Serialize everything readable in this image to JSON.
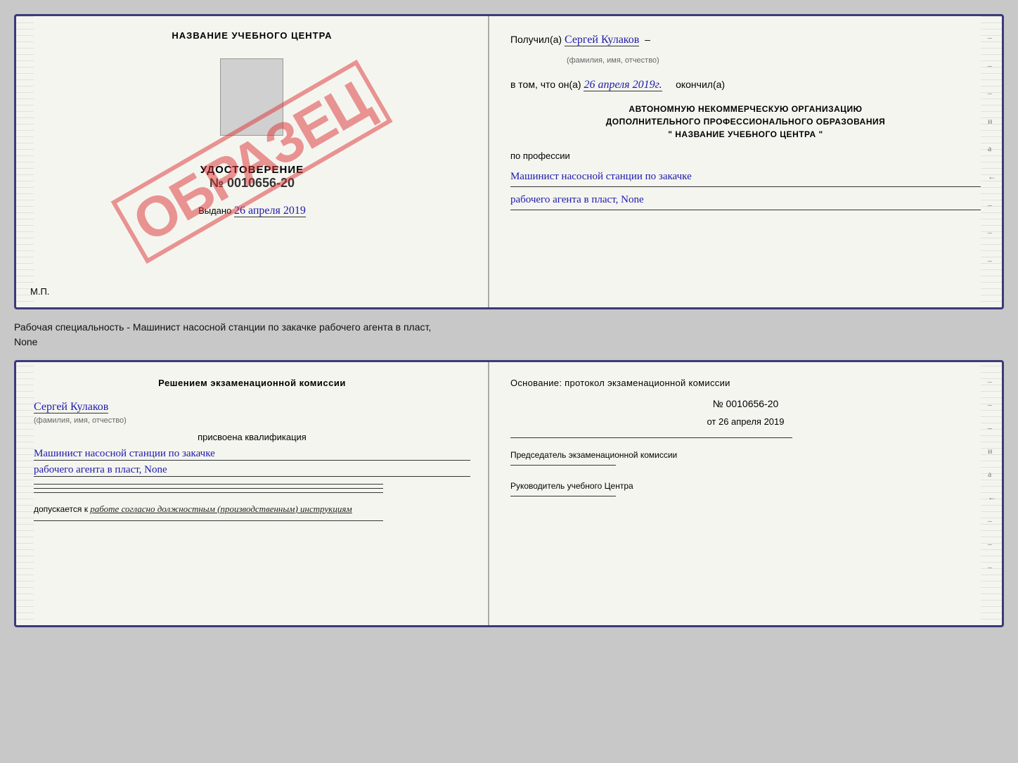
{
  "top_doc": {
    "left": {
      "title": "НАЗВАНИЕ УЧЕБНОГО ЦЕНТРА",
      "watermark": "ОБРАЗЕЦ",
      "udostoverenie": "УДОСТОВЕРЕНИЕ",
      "number": "№ 0010656-20",
      "vydano_label": "Выдано",
      "vydano_date": "26 апреля 2019",
      "mp": "М.П."
    },
    "right": {
      "poluchil_label": "Получил(a)",
      "recipient_name": "Сергей Кулаков",
      "recipient_subtitle": "(фамилия, имя, отчество)",
      "vtom_label": "в том, что он(а)",
      "date_value": "26 апреля 2019г.",
      "okonchil_label": "окончил(а)",
      "org_line1": "АВТОНОМНУЮ НЕКОММЕРЧЕСКУЮ ОРГАНИЗАЦИЮ",
      "org_line2": "ДОПОЛНИТЕЛЬНОГО ПРОФЕССИОНАЛЬНОГО ОБРАЗОВАНИЯ",
      "org_line3": "\"  НАЗВАНИЕ УЧЕБНОГО ЦЕНТРА  \"",
      "po_professii": "по профессии",
      "profession1": "Машинист насосной станции по закачке",
      "profession2": "рабочего агента в пласт, None"
    }
  },
  "subtitle": {
    "text1": "Рабочая специальность - Машинист насосной станции по закачке рабочего агента в пласт,",
    "text2": "None"
  },
  "bottom_doc": {
    "left": {
      "decision_title": "Решением  экзаменационной  комиссии",
      "person_name": "Сергей Кулаков",
      "person_subtitle": "(фамилия, имя, отчество)",
      "prisvoena": "присвоена квалификация",
      "qual1": "Машинист насосной станции по закачке",
      "qual2": "рабочего агента в пласт, None",
      "dopuskaetsya": "допускается к",
      "dopusk_text": "работе согласно должностным (производственным) инструкциям"
    },
    "right": {
      "osnovanie": "Основание: протокол экзаменационной  комиссии",
      "protocol_num": "№  0010656-20",
      "date_ot": "от",
      "date_val": "26 апреля 2019",
      "predsedatel_label": "Председатель экзаменационной комиссии",
      "rukovoditel_label": "Руководитель учебного Центра"
    }
  }
}
